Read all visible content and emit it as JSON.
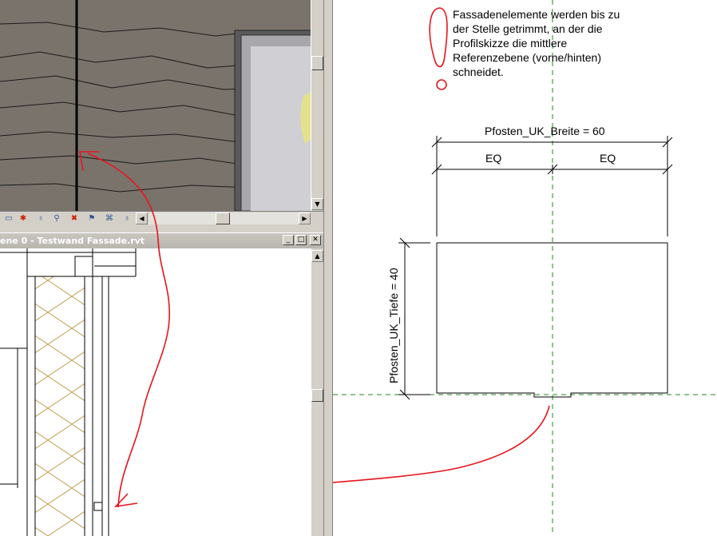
{
  "note": {
    "lines": [
      "Fassadenelemente werden bis zu",
      "der Stelle getrimmt, an der die",
      "Profilskizze die mittlere",
      "Referenzebene (vorne/hinten)",
      "schneidet."
    ]
  },
  "dimensions": {
    "width_label": "Pfosten_UK_Breite = 60",
    "eq_left": "EQ",
    "eq_right": "EQ",
    "depth_label": "Pfosten_UK_Tiefe = 40"
  },
  "view2": {
    "title": "ene 0 - Testwand Fassade.rvt"
  },
  "window_buttons": {
    "minimize": "_",
    "restore": "□",
    "close": "✕"
  },
  "scroll_glyphs": {
    "up": "▲",
    "down": "▼",
    "left": "◀",
    "right": "▶"
  },
  "toolbar_icons": [
    "model-graphics-style-icon",
    "hide-isolate-icon",
    "lightbulb-icon",
    "reveal-elements-icon",
    "temporary-hide-icon",
    "reveal-hidden-icon",
    "crop-region-icon",
    "shadows-icon"
  ],
  "colors": {
    "annotation_red": "#e8141c",
    "reference_plane_green": "#1f8a1f",
    "wall_brown": "#7a736c",
    "insulation_pattern": "#b8a455"
  }
}
